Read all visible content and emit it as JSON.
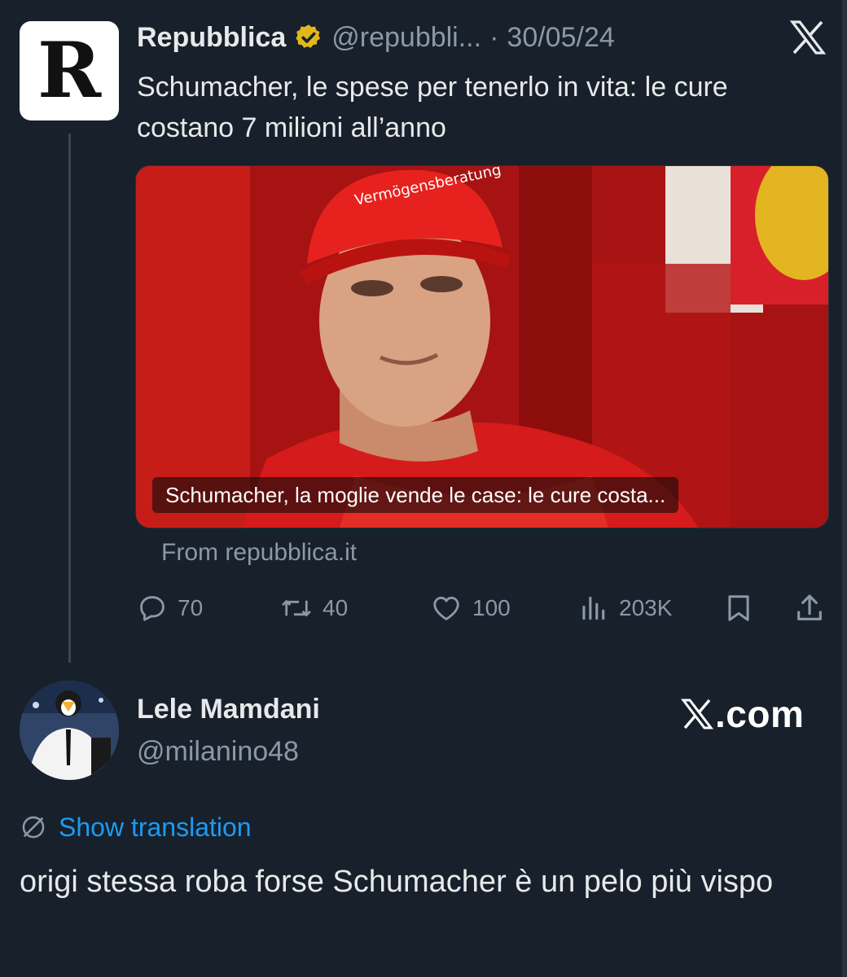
{
  "quoted_tweet": {
    "avatar_letter": "R",
    "display_name": "Repubblica",
    "handle": "@repubbli...",
    "separator": "·",
    "date": "30/05/24",
    "text": "Schumacher, le spese per tenerlo in vita: le cure costano 7 milioni all’anno",
    "media_caption": "Schumacher, la moglie vende le case: le cure costa...",
    "source": "From repubblica.it",
    "stats": {
      "replies": "70",
      "reposts": "40",
      "likes": "100",
      "views": "203K"
    }
  },
  "reply": {
    "display_name": "Lele Mamdani",
    "handle": "@milanino48",
    "watermark": ".com",
    "translate_label": "Show translation",
    "text": "origi stessa roba forse Schumacher è un pelo più vispo"
  },
  "colors": {
    "background": "#17202b",
    "text_primary": "#e7e9ea",
    "text_secondary": "#8b98a5",
    "link": "#1d9bf0",
    "verified_gold": "#e2b719"
  },
  "icons": [
    "verified-badge-icon",
    "x-logo-icon",
    "reply-icon",
    "repost-icon",
    "like-icon",
    "views-icon",
    "bookmark-icon",
    "share-icon",
    "translate-globe-icon"
  ]
}
